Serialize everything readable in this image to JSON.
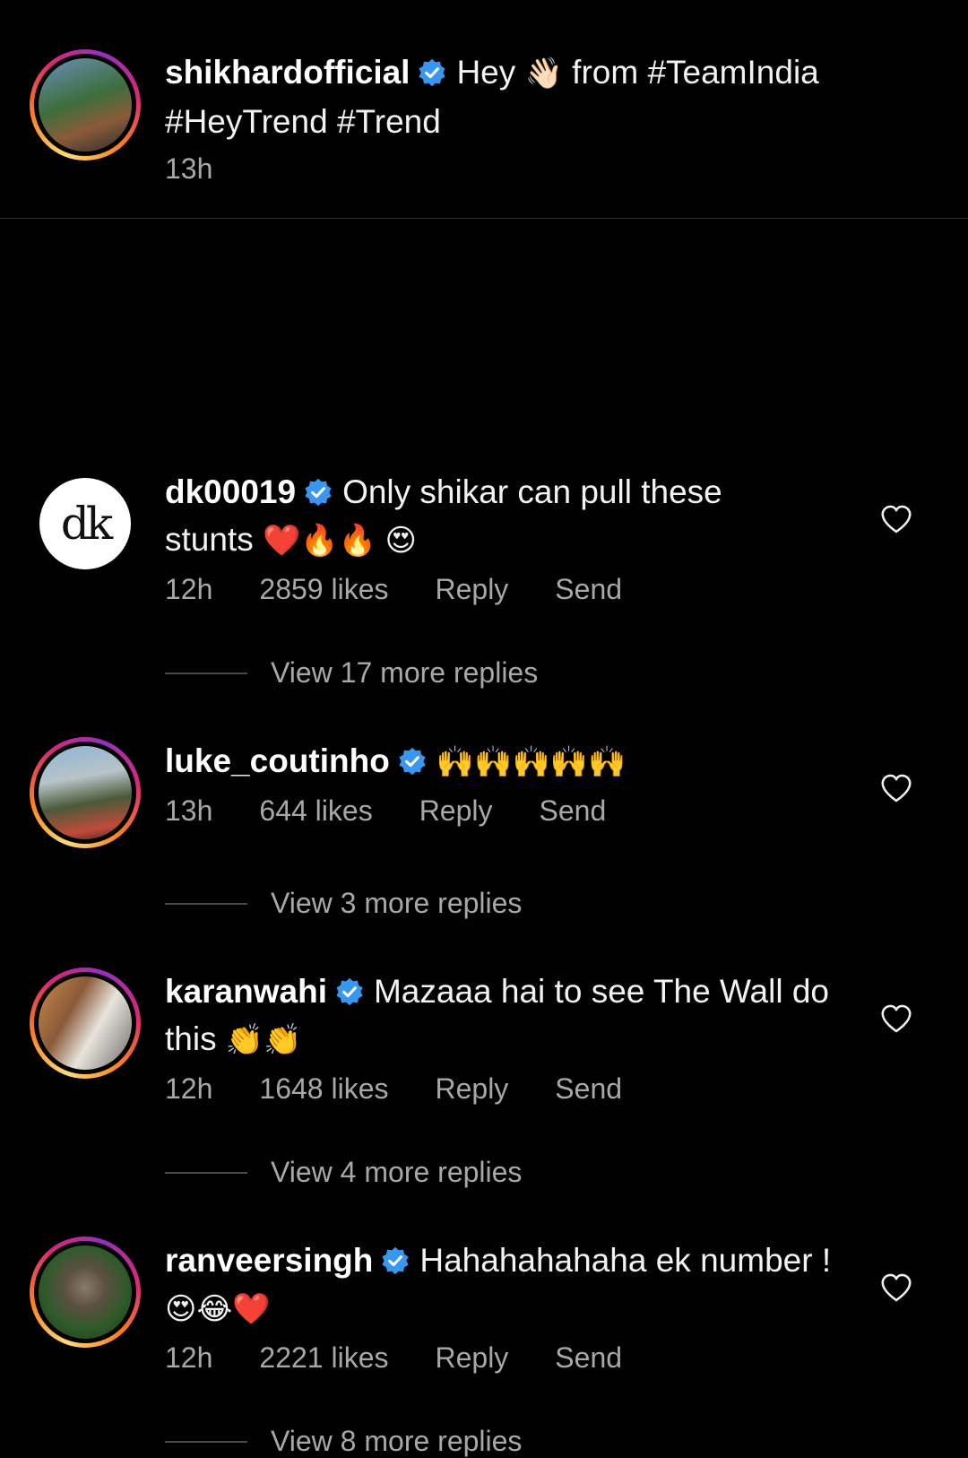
{
  "caption": {
    "username": "shikhardofficial",
    "text_before_emoji": "Hey",
    "emoji": "👋🏻",
    "text_after_emoji": "from #TeamIndia",
    "line2": "#HeyTrend #Trend",
    "time": "13h"
  },
  "comments": [
    {
      "username": "dk00019",
      "text": "Only shikar can pull these",
      "line2_text": "stunts",
      "emojis": "❤️🔥🔥 😍",
      "time": "12h",
      "likes": "2859 likes",
      "reply": "Reply",
      "send": "Send",
      "view_replies": "View 17 more replies"
    },
    {
      "username": "luke_coutinho",
      "emojis": "🙌🙌🙌🙌🙌",
      "time": "13h",
      "likes": "644 likes",
      "reply": "Reply",
      "send": "Send",
      "view_replies": "View 3 more replies"
    },
    {
      "username": "karanwahi",
      "text": "Mazaaa hai to see The Wall do",
      "line2_text": "this",
      "emojis": "👏👏",
      "time": "12h",
      "likes": "1648 likes",
      "reply": "Reply",
      "send": "Send",
      "view_replies": "View 4 more replies"
    },
    {
      "username": "ranveersingh",
      "text": "Hahahahahaha ek number !",
      "emojis": "😍😂❤️",
      "time": "12h",
      "likes": "2221 likes",
      "reply": "Reply",
      "send": "Send",
      "view_replies": "View 8 more replies"
    }
  ],
  "dk_logo": "dk",
  "colors": {
    "background": "#000000",
    "verified": "#3897f0",
    "muted": "#a8a8a8"
  }
}
